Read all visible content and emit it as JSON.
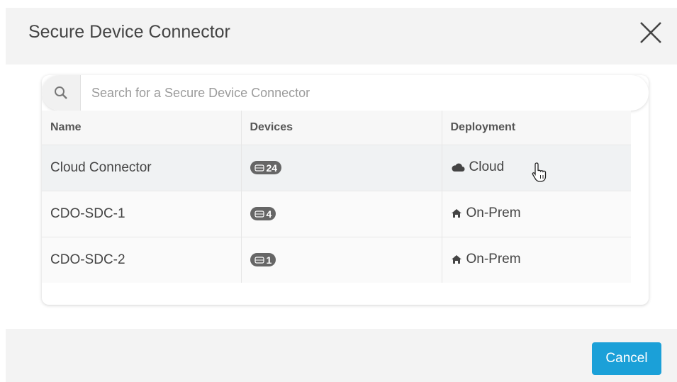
{
  "dialog": {
    "title": "Secure Device Connector",
    "cancel_label": "Cancel"
  },
  "search": {
    "placeholder": "Search for a Secure Device Connector",
    "value": ""
  },
  "table": {
    "headers": [
      "Name",
      "Devices",
      "Deployment"
    ],
    "rows": [
      {
        "name": "Cloud Connector",
        "devices": "24",
        "deployment": "Cloud",
        "deployment_icon": "cloud-icon"
      },
      {
        "name": "CDO-SDC-1",
        "devices": "4",
        "deployment": "On-Prem",
        "deployment_icon": "home-icon"
      },
      {
        "name": "CDO-SDC-2",
        "devices": "1",
        "deployment": "On-Prem",
        "deployment_icon": "home-icon"
      }
    ]
  },
  "colors": {
    "accent": "#1ba0d8",
    "badge": "#666666",
    "header_bg": "#f3f3f3"
  }
}
